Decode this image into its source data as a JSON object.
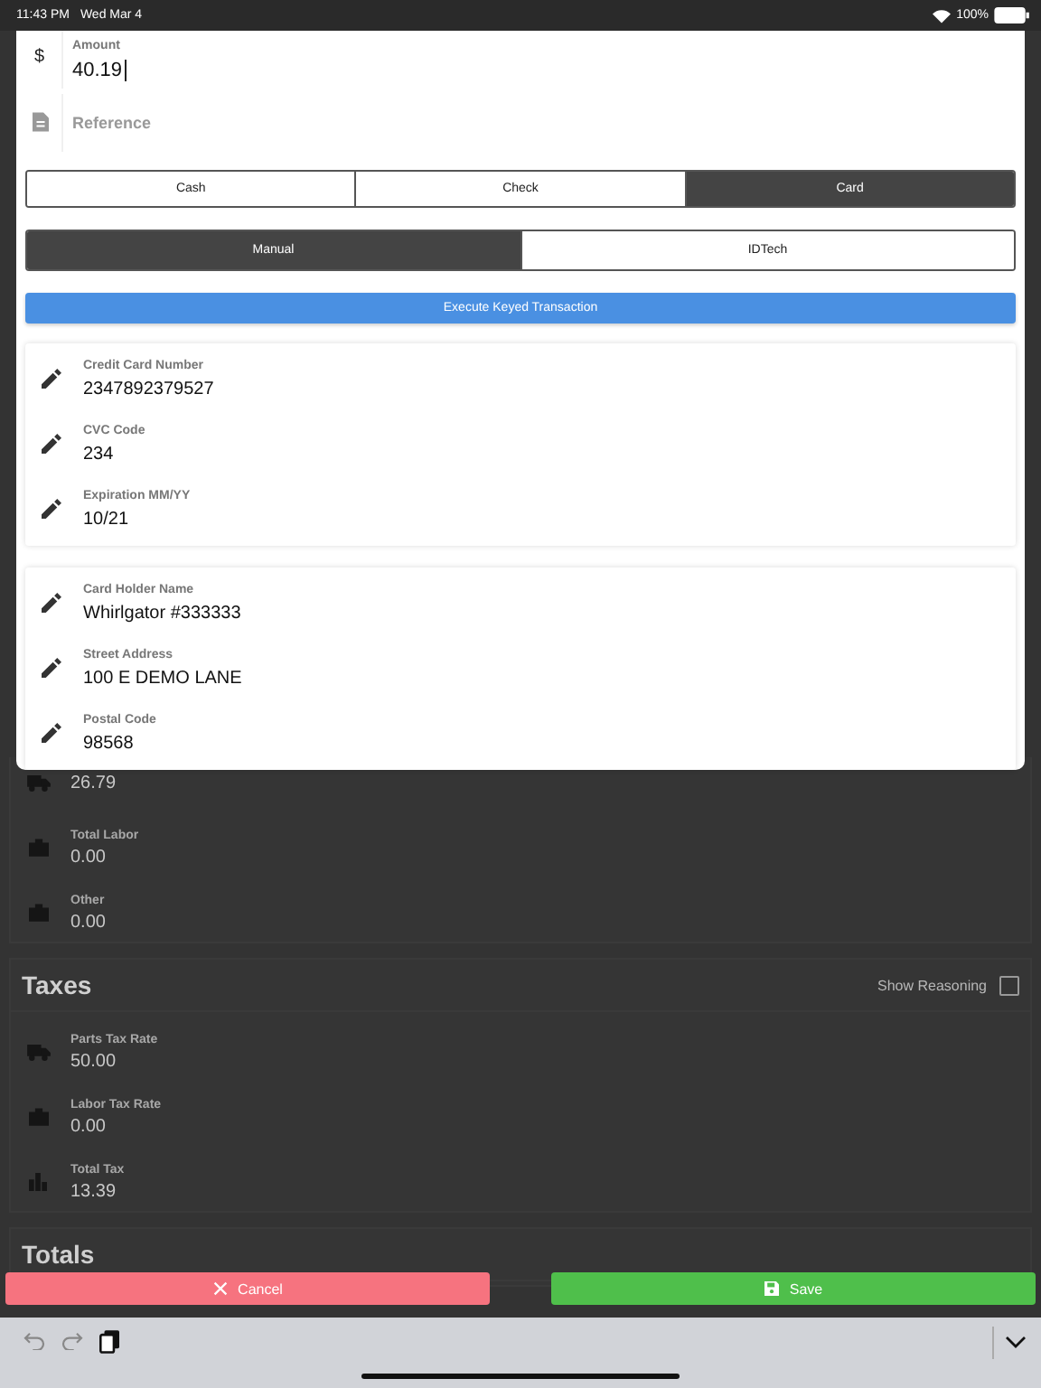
{
  "status_bar": {
    "time": "11:43 PM",
    "date": "Wed Mar 4",
    "battery": "100%"
  },
  "modal": {
    "amount": {
      "currency": "$",
      "label": "Amount",
      "value": "40.19"
    },
    "reference": {
      "placeholder": "Reference"
    },
    "payment_methods": [
      {
        "label": "Cash",
        "selected": false
      },
      {
        "label": "Check",
        "selected": false
      },
      {
        "label": "Card",
        "selected": true
      }
    ],
    "entry_modes": [
      {
        "label": "Manual",
        "selected": true
      },
      {
        "label": "IDTech",
        "selected": false
      }
    ],
    "execute_button": "Execute Keyed Transaction",
    "card_groups": [
      {
        "fields": [
          {
            "label": "Credit Card Number",
            "value": "2347892379527"
          },
          {
            "label": "CVC Code",
            "value": "234"
          },
          {
            "label": "Expiration MM/YY",
            "value": "10/21"
          }
        ]
      },
      {
        "fields": [
          {
            "label": "Card Holder Name",
            "value": "Whirlgator #333333"
          },
          {
            "label": "Street Address",
            "value": "100 E DEMO LANE"
          },
          {
            "label": "Postal Code",
            "value": "98568"
          }
        ]
      }
    ]
  },
  "summary": {
    "rows": [
      {
        "kind": "truck",
        "value": "26.79"
      },
      {
        "kind": "briefcase",
        "label": "Total Labor",
        "value": "0.00"
      },
      {
        "kind": "briefcase",
        "label": "Other",
        "value": "0.00"
      }
    ]
  },
  "taxes": {
    "title": "Taxes",
    "show_reasoning": {
      "label": "Show Reasoning",
      "checked": false
    },
    "rows": [
      {
        "kind": "truck",
        "label": "Parts Tax Rate",
        "value": "50.00"
      },
      {
        "kind": "briefcase",
        "label": "Labor Tax Rate",
        "value": "0.00"
      },
      {
        "kind": "buildings",
        "label": "Total Tax",
        "value": "13.39"
      }
    ]
  },
  "totals": {
    "title": "Totals"
  },
  "actions": {
    "cancel": "Cancel",
    "save": "Save"
  }
}
